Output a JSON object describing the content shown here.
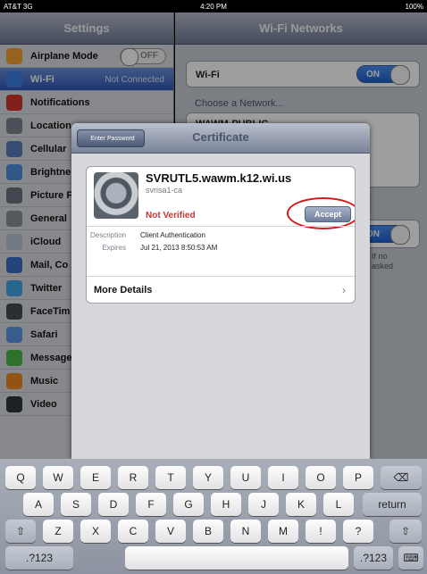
{
  "status_bar": {
    "carrier": "AT&T 3G",
    "time": "4:20 PM",
    "battery": "100%"
  },
  "settings": {
    "title": "Settings",
    "items": [
      {
        "label": "Airplane Mode",
        "value": "OFF",
        "icon": "airplane-icon",
        "color": "#f0a030"
      },
      {
        "label": "Wi-Fi",
        "value": "Not Connected",
        "icon": "wifi-icon",
        "color": "#3b7de0",
        "selected": true
      },
      {
        "label": "Notifications",
        "icon": "notifications-icon",
        "color": "#d0342c"
      },
      {
        "label": "Location",
        "icon": "location-icon",
        "color": "#7a8290"
      },
      {
        "label": "Cellular",
        "icon": "cellular-icon",
        "color": "#5a7bb8"
      },
      {
        "label": "Brightne",
        "icon": "brightness-icon",
        "color": "#4f8fd9"
      },
      {
        "label": "Picture F",
        "icon": "picture-frame-icon",
        "color": "#6c7380"
      },
      {
        "label": "General",
        "icon": "general-icon",
        "color": "#8a8f98"
      },
      {
        "label": "iCloud",
        "icon": "icloud-icon",
        "color": "#b9c3d2"
      },
      {
        "label": "Mail, Co",
        "icon": "mail-icon",
        "color": "#3d6fc6"
      },
      {
        "label": "Twitter",
        "icon": "twitter-icon",
        "color": "#40a6e6"
      },
      {
        "label": "FaceTim",
        "icon": "facetime-icon",
        "color": "#444c56"
      },
      {
        "label": "Safari",
        "icon": "safari-icon",
        "color": "#5b96e2"
      },
      {
        "label": "Message",
        "icon": "messages-icon",
        "color": "#49b649"
      },
      {
        "label": "Music",
        "icon": "music-icon",
        "color": "#e88a1e"
      },
      {
        "label": "Video",
        "icon": "video-icon",
        "color": "#2f343b"
      }
    ]
  },
  "wifi_networks": {
    "title": "Wi-Fi Networks",
    "wifi_label": "Wi-Fi",
    "wifi_toggle": "ON",
    "choose_label": "Choose a Network...",
    "network_1": "WAWM-PUBLIC",
    "ask_toggle": "ON",
    "ask_text_1": "If no",
    "ask_text_2": "asked"
  },
  "certificate_dialog": {
    "back_label": "Enter Password",
    "title": "Certificate",
    "cert_name": "SVRUTL5.wawm.k12.wi.us",
    "issuer": "svrisa1-ca",
    "status": "Not Verified",
    "accept_label": "Accept",
    "description_key": "Description",
    "description_value": "Client Authentication",
    "expires_key": "Expires",
    "expires_value": "Jul 21, 2013 8:50:53 AM",
    "more_details": "More Details"
  },
  "keyboard": {
    "row1": [
      "Q",
      "W",
      "E",
      "R",
      "T",
      "Y",
      "U",
      "I",
      "O",
      "P"
    ],
    "row2": [
      "A",
      "S",
      "D",
      "F",
      "G",
      "H",
      "J",
      "K",
      "L"
    ],
    "row3": [
      "Z",
      "X",
      "C",
      "V",
      "B",
      "N",
      "M",
      "!",
      "?"
    ],
    "return_label": "return",
    "mode_label": ".?123"
  }
}
